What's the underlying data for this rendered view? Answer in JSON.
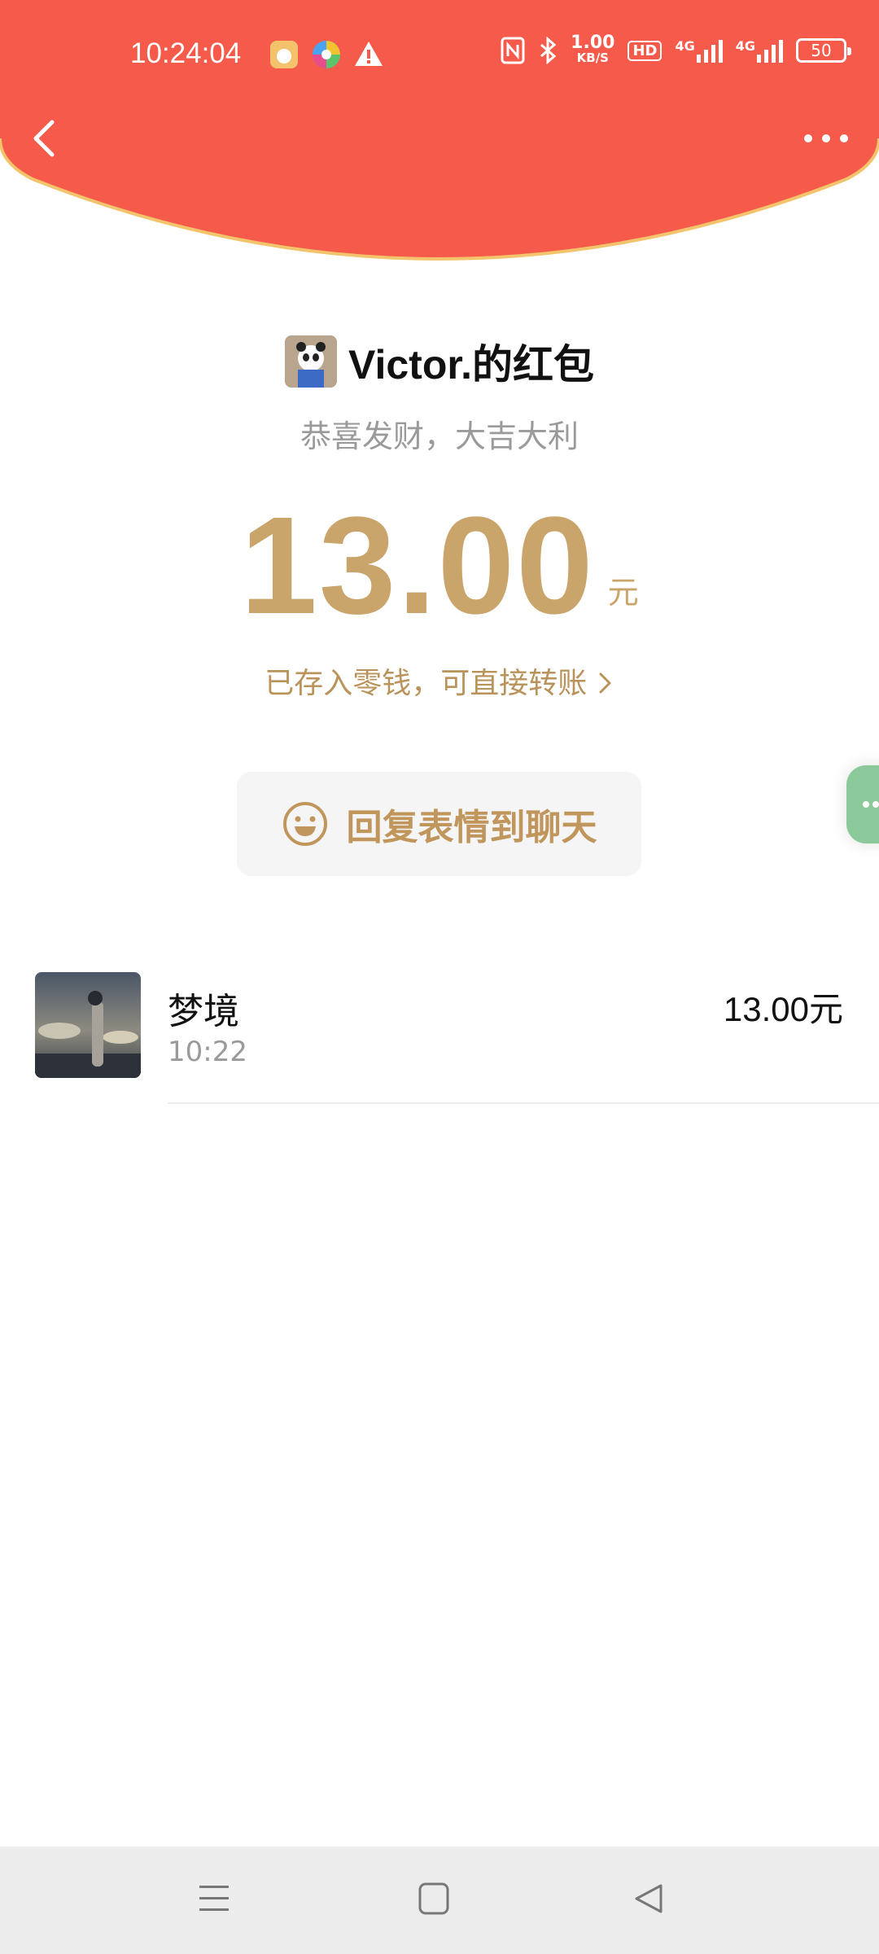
{
  "status_bar": {
    "time": "10:24:04",
    "net_speed_value": "1.00",
    "net_speed_unit": "KB/S",
    "hd_label": "HD",
    "signal1_label": "4G",
    "signal2_label": "4G",
    "battery": "50"
  },
  "header": {
    "bg_color": "#f55a4a",
    "back_icon": "chevron-left-icon",
    "more_icon": "more-dots-icon"
  },
  "packet": {
    "sender_title": "Victor.的红包",
    "greeting": "恭喜发财，大吉大利",
    "amount": "13.00",
    "unit": "元",
    "saved_link": "已存入零钱，可直接转账",
    "accent_color": "#c9a56b"
  },
  "reply_button": {
    "label": "回复表情到聊天",
    "icon": "smiley-icon"
  },
  "receivers": [
    {
      "name": "梦境",
      "time": "10:22",
      "amount": "13.00元"
    }
  ],
  "nav_bar": {
    "icons": [
      "menu-icon",
      "home-square-icon",
      "back-triangle-icon"
    ]
  }
}
